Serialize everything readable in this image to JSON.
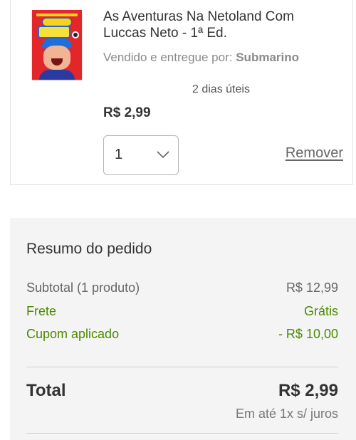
{
  "product": {
    "title": "As Aventuras Na Netoland Com Luccas Neto - 1ª Ed.",
    "seller_prefix": "Vendido e entregue por:",
    "seller_name": "Submarino",
    "delivery": "2 dias úteis",
    "price": "R$ 2,99",
    "quantity": "1",
    "remove_label": "Remover",
    "cover_logo_text": "Luccas Neto"
  },
  "summary": {
    "title": "Resumo do pedido",
    "subtotal_label": "Subtotal (1 produto)",
    "subtotal_value": "R$ 12,99",
    "frete_label": "Frete",
    "frete_value": "Grátis",
    "cupom_label": "Cupom aplicado",
    "cupom_value": "- R$ 10,00",
    "total_label": "Total",
    "total_value": "R$ 2,99",
    "installments": "Em até 1x s/ juros"
  },
  "colors": {
    "green": "#4a8a00",
    "summary_bg": "#f4f4f4",
    "text": "#333333",
    "muted": "#8a8a8a"
  },
  "icons": {
    "quantity_dropdown": "chevron-down-icon"
  }
}
